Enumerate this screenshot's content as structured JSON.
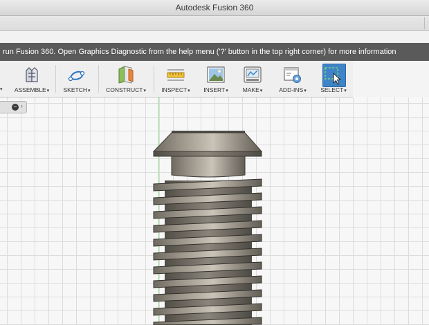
{
  "app": {
    "title": "Autodesk Fusion 360"
  },
  "warning": {
    "text": "run Fusion 360. Open Graphics Diagnostic from the help menu ('?' button in the top right corner) for more information"
  },
  "toolbar": {
    "caret": "▾",
    "items": [
      {
        "label": "ASSEMBLE",
        "icon": "assemble-icon"
      },
      {
        "label": "SKETCH",
        "icon": "sketch-icon"
      },
      {
        "label": "CONSTRUCT",
        "icon": "construct-icon"
      },
      {
        "label": "INSPECT",
        "icon": "inspect-icon"
      },
      {
        "label": "INSERT",
        "icon": "insert-icon"
      },
      {
        "label": "MAKE",
        "icon": "make-icon"
      },
      {
        "label": "ADD-INS",
        "icon": "add-ins-icon"
      },
      {
        "label": "SELECT",
        "icon": "select-icon",
        "active": true
      }
    ],
    "accent": "#3e84c6"
  },
  "browser": {
    "collapse_glyph": "−",
    "expand_glyph": "›"
  },
  "viewport": {
    "grid_color": "#dcdcdc",
    "axis_color": "#8fe08f",
    "model": "threaded-screw"
  }
}
